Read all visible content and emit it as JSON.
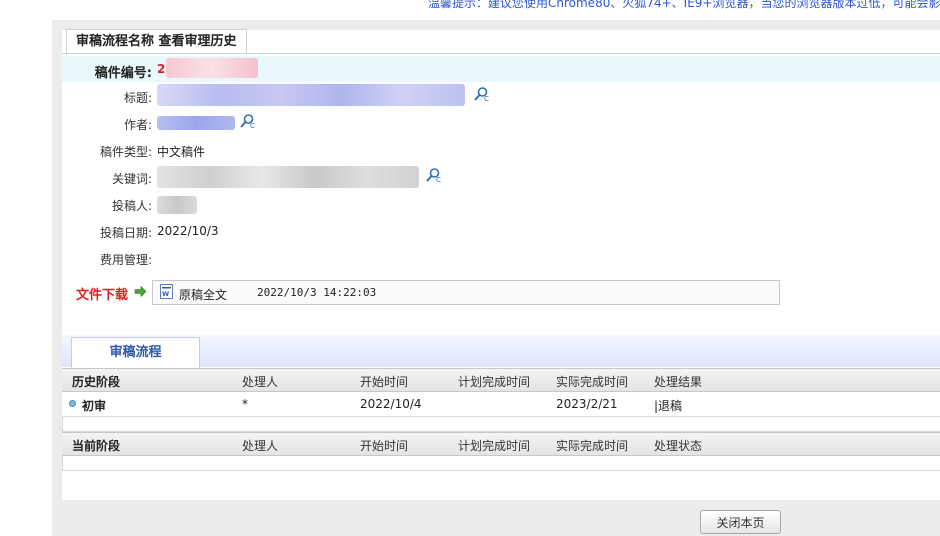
{
  "notice": "温馨提示：建议您使用Chrome80、火狐74+、IE9+浏览器，当您的浏览器版本过低，可能会影响",
  "page_title": "审稿流程名称 查看审理历史",
  "manuscript": {
    "id_label": "稿件编号:",
    "id_value": "2",
    "title_label": "标题:",
    "author_label": "作者:",
    "type_label": "稿件类型:",
    "type_value": "中文稿件",
    "keywords_label": "关键词:",
    "submitter_label": "投稿人:",
    "date_label": "投稿日期:",
    "date_value": "2022/10/3",
    "fee_label": "费用管理:"
  },
  "download": {
    "label": "文件下载",
    "file_name": "原稿全文",
    "file_date": "2022/10/3 14:22:03"
  },
  "review": {
    "tab_label": "审稿流程",
    "history_headers": [
      "历史阶段",
      "处理人",
      "开始时间",
      "计划完成时间",
      "实际完成时间",
      "处理结果"
    ],
    "history_rows": [
      {
        "stage": "初审",
        "handler": "*",
        "start": "2022/10/4",
        "planned": "",
        "actual": "2023/2/21",
        "result": "|退稿"
      }
    ],
    "current_headers": [
      "当前阶段",
      "处理人",
      "开始时间",
      "计划完成时间",
      "实际完成时间",
      "处理状态"
    ]
  },
  "close_button": "关闭本页",
  "colors": {
    "accent_red": "#e02020",
    "link_blue": "#2b56d9",
    "section_blue": "#2d58a8",
    "highlight_row": "#e9f8fd"
  },
  "icons": {
    "author_search": "magnifier-c-icon",
    "download_arrow": "green-right-arrow-icon",
    "file": "word-doc-icon",
    "stage_dot": "blue-dot-icon"
  }
}
